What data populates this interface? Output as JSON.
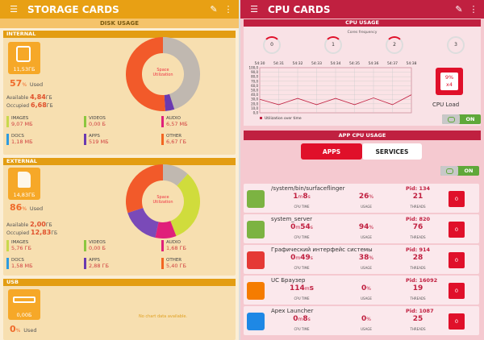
{
  "left": {
    "title": "STORAGE CARDS",
    "subheader": "DISK USAGE",
    "internal": {
      "label": "INTERNAL",
      "tile_value": "11,53ГБ",
      "percent": "57",
      "pct_unit": "%",
      "used_label": "Used",
      "available_label": "Available",
      "available_value": "4,84",
      "available_unit": "ГБ",
      "occupied_label": "Occupied",
      "occupied_value": "6,68",
      "occupied_unit": "ГБ",
      "donut_label": [
        "Space",
        "Utilization"
      ],
      "categories": [
        {
          "name": "IMAGES",
          "value": "9,07 МБ",
          "color": "#c8d84c"
        },
        {
          "name": "VIDEOS",
          "value": "0,00 Б",
          "color": "#8cc63f"
        },
        {
          "name": "AUDIO",
          "value": "6,57 МБ",
          "color": "#e0207a"
        },
        {
          "name": "DOCS",
          "value": "1,18 МБ",
          "color": "#2d9be0"
        },
        {
          "name": "APPS",
          "value": "519 МБ",
          "color": "#6a3ab0"
        },
        {
          "name": "OTHER",
          "value": "6,67 ГБ",
          "color": "#f26522"
        }
      ],
      "donut": [
        {
          "value": 45,
          "color": "#c0b8b0"
        },
        {
          "value": 4,
          "color": "#6a3ab0"
        },
        {
          "value": 51,
          "color": "#f25a2a"
        }
      ]
    },
    "external": {
      "label": "EXTERNAL",
      "tile_value": "14,83ГБ",
      "percent": "86",
      "pct_unit": "%",
      "used_label": "Used",
      "available_label": "Available",
      "available_value": "2,00",
      "available_unit": "ГБ",
      "occupied_label": "Occupied",
      "occupied_value": "12,83",
      "occupied_unit": "ГБ",
      "donut_label": [
        "Space",
        "Utilization"
      ],
      "categories": [
        {
          "name": "IMAGES",
          "value": "5,76 ГБ",
          "color": "#c8d84c"
        },
        {
          "name": "VIDEOS",
          "value": "0,00 Б",
          "color": "#8cc63f"
        },
        {
          "name": "AUDIO",
          "value": "1,68 ГБ",
          "color": "#e0207a"
        },
        {
          "name": "DOCS",
          "value": "1,58 МБ",
          "color": "#2d9be0"
        },
        {
          "name": "APPS",
          "value": "2,88 ГБ",
          "color": "#6a3ab0"
        },
        {
          "name": "OTHER",
          "value": "5,40 ГБ",
          "color": "#f26522"
        }
      ],
      "donut": [
        {
          "value": 14,
          "color": "#c0b8b0"
        },
        {
          "value": 39,
          "color": "#d0dc3c"
        },
        {
          "value": 11,
          "color": "#e0207a"
        },
        {
          "value": 20,
          "color": "#7a4ab8"
        },
        {
          "value": 36,
          "color": "#f25a2a"
        }
      ]
    },
    "usb": {
      "label": "USB",
      "tile_value": "0,00Б",
      "percent": "0",
      "pct_unit": "%",
      "used_label": "Used",
      "no_data": "No chart data available."
    }
  },
  "right": {
    "title": "CPU CARDS",
    "cpu_usage_header": "CPU USAGE",
    "cores_label": "Cores frequency",
    "cores": [
      "0",
      "1",
      "2",
      "3"
    ],
    "times": [
      "54:30",
      "54:31",
      "54:32",
      "54:33",
      "54:34",
      "54:35",
      "54:36",
      "54:37",
      "54:38"
    ],
    "y_ticks": [
      "100,0",
      "90,0",
      "80,0",
      "70,0",
      "60,0",
      "50,0",
      "40,0",
      "30,0",
      "20,0",
      "10,0",
      "0,0"
    ],
    "legend": "Utilization over time",
    "cpu_load_value": "9%",
    "cpu_load_cores": "x4",
    "cpu_load_label": "CPU Load",
    "toggle_label": "ON",
    "app_header": "APP CPU USAGE",
    "tab_apps": "APPS",
    "tab_services": "SERVICES",
    "cap_time": "CPU TIME",
    "cap_usage": "USAGE",
    "cap_threads": "THREADS",
    "apps": [
      {
        "name": "/system/bin/surfaceflinger",
        "pid": "Pid: 134",
        "t1": "1",
        "tu1": "m",
        "t2": "8",
        "tu2": "s",
        "usage": "26",
        "threads": "21",
        "chip": "0",
        "icon": "#7cb342"
      },
      {
        "name": "system_server",
        "pid": "Pid: 820",
        "t1": "0",
        "tu1": "m",
        "t2": "54",
        "tu2": "s",
        "usage": "94",
        "threads": "76",
        "chip": "0",
        "icon": "#7cb342"
      },
      {
        "name": "Графический интерфейс системы",
        "pid": "Pid: 914",
        "t1": "0",
        "tu1": "m",
        "t2": "49",
        "tu2": "s",
        "usage": "38",
        "threads": "28",
        "chip": "0",
        "icon": "#e53935"
      },
      {
        "name": "UC Браузер",
        "pid": "Pid: 16092",
        "t1": "114",
        "tu1": "m",
        "t2": "s",
        "tu2": "",
        "usage": "0",
        "threads": "19",
        "chip": "0",
        "icon": "#f57c00"
      },
      {
        "name": "Apex Launcher",
        "pid": "Pid: 1087",
        "t1": "0",
        "tu1": "m",
        "t2": "8",
        "tu2": "s",
        "usage": "0",
        "threads": "25",
        "chip": "0",
        "icon": "#1e88e5"
      }
    ]
  },
  "chart_data": {
    "type": "line",
    "title": "",
    "xlabel": "",
    "ylabel": "",
    "x": [
      "54:30",
      "54:31",
      "54:32",
      "54:33",
      "54:34",
      "54:35",
      "54:36",
      "54:37",
      "54:38"
    ],
    "ylim": [
      0,
      100
    ],
    "series": [
      {
        "name": "Utilization over time",
        "values": [
          30,
          18,
          32,
          18,
          32,
          18,
          33,
          18,
          40
        ]
      }
    ]
  }
}
